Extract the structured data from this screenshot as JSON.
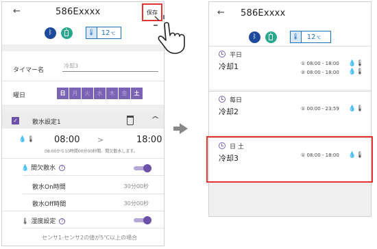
{
  "left_screen": {
    "back_glyph": "←",
    "title": "586Exxxx",
    "save_label": "保存",
    "temperature": "12",
    "temperature_unit": "℃",
    "timer_name_label": "タイマー名",
    "timer_name_placeholder": "冷却3",
    "weekday_label": "曜日",
    "days": [
      {
        "label": "日",
        "selected": true
      },
      {
        "label": "月",
        "selected": false
      },
      {
        "label": "火",
        "selected": false
      },
      {
        "label": "水",
        "selected": false
      },
      {
        "label": "木",
        "selected": false
      },
      {
        "label": "金",
        "selected": false
      },
      {
        "label": "土",
        "selected": true
      }
    ],
    "setting_title": "散水設定1",
    "start_time": "08:00",
    "arrow_glyph": ">",
    "end_time": "18:00",
    "time_note": "08:00から10時間00分00秒間、間欠散水します。",
    "intermittent_label": "間欠散水",
    "on_time_label": "散水On時間",
    "on_time_value": "30分00秒",
    "off_time_label": "散水Off時間",
    "off_time_value": "30分00秒",
    "humidity_label": "湿度設定",
    "footnote": "センサ1-センサ2の値が5℃以上の場合"
  },
  "right_screen": {
    "back_glyph": "←",
    "title": "586Exxxx",
    "temperature": "12",
    "temperature_unit": "℃",
    "schedules": [
      {
        "days": "平日",
        "name": "冷却1",
        "ranges": [
          "① 08:00 - 18:00",
          "② 08:00 - 18:00"
        ]
      },
      {
        "days": "毎日",
        "name": "冷却2",
        "ranges": [
          "① 00:00 - 23:59"
        ]
      },
      {
        "days": "日 土",
        "name": "冷却3",
        "ranges": [
          "① 08:00 - 18:00"
        ]
      }
    ]
  },
  "colors": {
    "accent_purple": "#6b51a7",
    "highlight_red": "#e4332f",
    "bluetooth_blue": "#1d4a9a",
    "battery_green": "#2aa88d",
    "temp_blue": "#1e6fb8"
  }
}
